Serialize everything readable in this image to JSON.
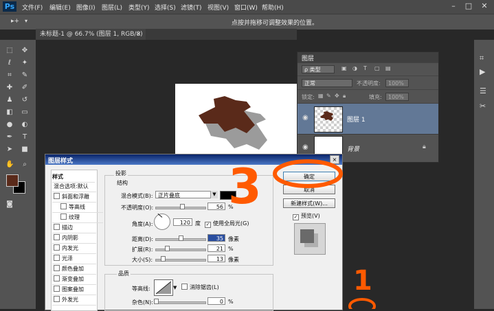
{
  "app": {
    "logo": "Ps"
  },
  "menu": [
    "文件(F)",
    "编辑(E)",
    "图像(I)",
    "图层(L)",
    "类型(Y)",
    "选择(S)",
    "滤镜(T)",
    "视图(V)",
    "窗口(W)",
    "帮助(H)"
  ],
  "window_controls": {
    "minimize": "–",
    "maximize": "□",
    "close": "✕"
  },
  "options_bar": {
    "hint": "点按并拖移可调整效果的位置。",
    "tool_glyph": "▸+"
  },
  "document": {
    "tab": "未标题-1 @ 66.7% (图层 1, RGB/8) *",
    "tab_close": "×"
  },
  "layers_panel": {
    "title": "图层",
    "filter_label": "ρ 类型",
    "blend_mode": "正常",
    "opacity_label": "不透明度:",
    "opacity_value": "100%",
    "lock_label": "锁定:",
    "fill_label": "填充:",
    "fill_value": "100%",
    "layers": [
      {
        "name": "图层 1",
        "selected": true
      },
      {
        "name": "背景",
        "selected": false
      }
    ]
  },
  "dialog": {
    "title": "图层样式",
    "close": "×",
    "styles_header": "样式",
    "styles_items": [
      {
        "label": "混合选项:默认",
        "checkbox": false,
        "indent": false
      },
      {
        "label": "斜面和浮雕",
        "checkbox": true,
        "indent": false
      },
      {
        "label": "等高线",
        "checkbox": true,
        "indent": true
      },
      {
        "label": "纹理",
        "checkbox": true,
        "indent": true
      },
      {
        "label": "描边",
        "checkbox": true,
        "indent": false
      },
      {
        "label": "内阴影",
        "checkbox": true,
        "indent": false
      },
      {
        "label": "内发光",
        "checkbox": true,
        "indent": false
      },
      {
        "label": "光泽",
        "checkbox": true,
        "indent": false
      },
      {
        "label": "颜色叠加",
        "checkbox": true,
        "indent": false
      },
      {
        "label": "渐变叠加",
        "checkbox": true,
        "indent": false
      },
      {
        "label": "图案叠加",
        "checkbox": true,
        "indent": false
      },
      {
        "label": "外发光",
        "checkbox": true,
        "indent": false
      }
    ],
    "section_title": "投影",
    "structure_label": "结构",
    "blend_label": "混合模式(B):",
    "blend_value": "正片叠底",
    "opacity_label": "不透明度(O):",
    "opacity_value": "56",
    "percent": "%",
    "angle_label": "角度(A):",
    "angle_value": "120",
    "degree": "度",
    "global_light_label": "使用全局光(G)",
    "distance_label": "距离(D):",
    "distance_value": "35",
    "spread_label": "扩展(R):",
    "spread_value": "21",
    "size_label": "大小(S):",
    "size_value": "13",
    "px_unit": "像素",
    "quality_label": "品质",
    "contour_label": "等高线:",
    "antialias_label": "消除锯齿(L)",
    "noise_label": "杂色(N):",
    "noise_value": "0",
    "ok": "确定",
    "cancel": "取消",
    "new_style": "新建样式(W)...",
    "preview": "预览(V)"
  },
  "annotations": {
    "three": "3",
    "one": "1"
  },
  "colors": {
    "shape": "#5a2a1a",
    "shadow": "#8a8a8a",
    "annotation": "#ff5a00",
    "dialog_title": "#0a246a",
    "selected_layer": "#627896"
  }
}
